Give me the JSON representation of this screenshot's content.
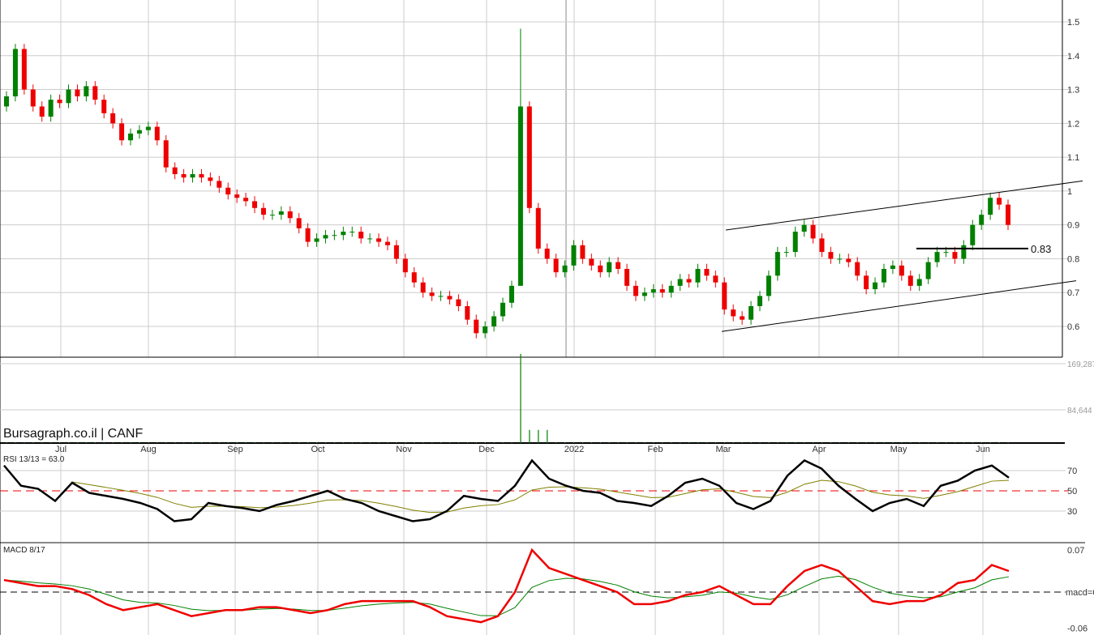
{
  "brand": "Bursagraph.co.il | CANF",
  "chart_data": {
    "type": "candlestick",
    "ticker": "CANF",
    "months": [
      "Jul",
      "Aug",
      "Sep",
      "Oct",
      "Nov",
      "Dec",
      "2022",
      "Feb",
      "Mar",
      "Apr",
      "May",
      "Jun"
    ],
    "price_ticks": [
      "1.5",
      "1.4",
      "1.3",
      "1.2",
      "1.1",
      "1",
      "0.9",
      "0.8",
      "0.7",
      "0.6"
    ],
    "ylim": [
      0.6,
      1.5
    ],
    "closes": [
      1.28,
      1.42,
      1.3,
      1.25,
      1.22,
      1.27,
      1.26,
      1.3,
      1.28,
      1.31,
      1.27,
      1.23,
      1.2,
      1.15,
      1.17,
      1.18,
      1.19,
      1.15,
      1.07,
      1.05,
      1.04,
      1.05,
      1.04,
      1.03,
      1.01,
      0.99,
      0.98,
      0.97,
      0.95,
      0.93,
      0.93,
      0.94,
      0.92,
      0.89,
      0.85,
      0.86,
      0.87,
      0.87,
      0.88,
      0.88,
      0.86,
      0.86,
      0.85,
      0.84,
      0.8,
      0.76,
      0.73,
      0.7,
      0.69,
      0.69,
      0.68,
      0.66,
      0.62,
      0.58,
      0.6,
      0.63,
      0.67,
      0.72,
      1.25,
      0.95,
      0.83,
      0.8,
      0.76,
      0.78,
      0.84,
      0.8,
      0.78,
      0.76,
      0.79,
      0.77,
      0.72,
      0.69,
      0.7,
      0.71,
      0.7,
      0.72,
      0.74,
      0.73,
      0.77,
      0.75,
      0.73,
      0.65,
      0.63,
      0.62,
      0.66,
      0.69,
      0.75,
      0.82,
      0.82,
      0.88,
      0.9,
      0.86,
      0.82,
      0.8,
      0.8,
      0.79,
      0.75,
      0.71,
      0.73,
      0.77,
      0.78,
      0.75,
      0.72,
      0.74,
      0.79,
      0.82,
      0.82,
      0.8,
      0.84,
      0.9,
      0.93,
      0.98,
      0.96,
      0.9
    ],
    "support_level": {
      "value": 0.83,
      "label": "0.83"
    },
    "channel": {
      "upper": [
        0.885,
        1.03
      ],
      "lower": [
        0.585,
        0.735
      ]
    },
    "volume": {
      "ticks": [
        "169,287",
        "84,644"
      ],
      "max": 169287,
      "spike_index": 58,
      "spike_value": 169287
    },
    "rsi": {
      "label": "RSI 13/13 = 63.0",
      "ticks": [
        "70",
        "50",
        "30"
      ],
      "values": [
        75,
        55,
        52,
        40,
        58,
        48,
        45,
        42,
        38,
        32,
        20,
        22,
        38,
        35,
        33,
        30,
        36,
        40,
        45,
        50,
        42,
        38,
        30,
        25,
        20,
        22,
        30,
        45,
        42,
        40,
        55,
        80,
        62,
        55,
        50,
        48,
        40,
        38,
        35,
        45,
        58,
        62,
        55,
        38,
        32,
        40,
        65,
        80,
        72,
        55,
        42,
        30,
        38,
        42,
        35,
        55,
        60,
        70,
        75,
        63
      ]
    },
    "macd": {
      "label": "MACD 8/17",
      "ticks": [
        "0.07",
        "macd=0",
        "-0.06"
      ],
      "values": [
        0.02,
        0.015,
        0.01,
        0.01,
        0.005,
        -0.005,
        -0.02,
        -0.03,
        -0.025,
        -0.02,
        -0.03,
        -0.04,
        -0.035,
        -0.03,
        -0.03,
        -0.025,
        -0.025,
        -0.03,
        -0.035,
        -0.03,
        -0.02,
        -0.015,
        -0.015,
        -0.015,
        -0.015,
        -0.025,
        -0.04,
        -0.045,
        -0.05,
        -0.04,
        0.0,
        0.07,
        0.04,
        0.03,
        0.02,
        0.01,
        0.0,
        -0.02,
        -0.02,
        -0.015,
        -0.005,
        0.0,
        0.01,
        -0.005,
        -0.02,
        -0.02,
        0.01,
        0.035,
        0.045,
        0.035,
        0.01,
        -0.015,
        -0.02,
        -0.015,
        -0.015,
        -0.005,
        0.015,
        0.02,
        0.045,
        0.035
      ]
    },
    "colors": {
      "up": "#008000",
      "down": "#ee0000",
      "signal_rsi": "#808000",
      "signal_macd": "#008000",
      "macd": "#ee0000"
    }
  }
}
